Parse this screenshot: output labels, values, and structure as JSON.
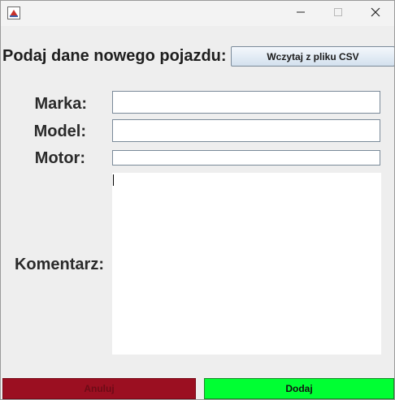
{
  "titlebar": {
    "icon": "java-app-icon",
    "controls": [
      "minimize-icon",
      "maximize-icon",
      "close-icon"
    ]
  },
  "header": {
    "title": "Podaj dane nowego pojazdu:",
    "csv_button": "Wczytaj z pliku CSV"
  },
  "form": {
    "marka": {
      "label": "Marka:",
      "value": ""
    },
    "model": {
      "label": "Model:",
      "value": ""
    },
    "motor": {
      "label": "Motor:",
      "value": ""
    },
    "komentarz": {
      "label": "Komentarz:",
      "value": ""
    }
  },
  "footer": {
    "cancel_label": "Anuluj",
    "add_label": "Dodaj"
  },
  "colors": {
    "cancel_bg": "#9b0f21",
    "add_bg": "#00ff33",
    "window_bg": "#eeeeee"
  }
}
